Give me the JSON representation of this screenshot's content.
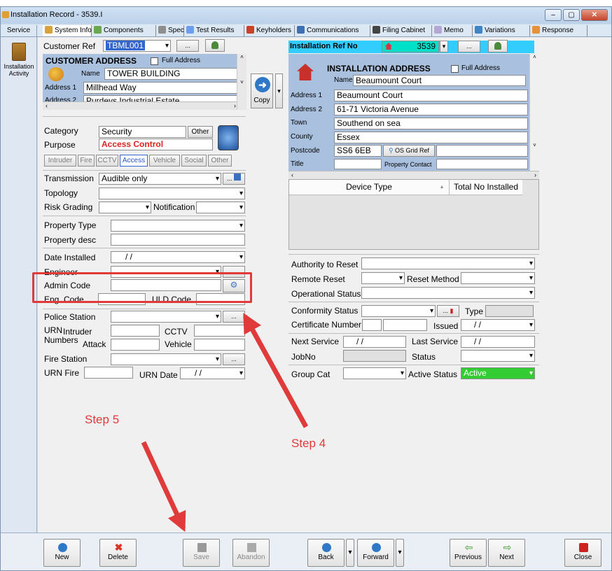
{
  "window": {
    "title": "Installation Record - 3539.I",
    "min": "–",
    "max": "▢",
    "close": "✕"
  },
  "sidebar": {
    "service_tab": "Service",
    "item_label": "Installation Activity"
  },
  "tabs": [
    {
      "label": "System Info",
      "color": "#d9a13a"
    },
    {
      "label": "Components",
      "color": "#6aa84f"
    },
    {
      "label": "Spec",
      "color": "#8e8e8e"
    },
    {
      "label": "Test Results",
      "color": "#6d9eeb"
    },
    {
      "label": "Keyholders",
      "color": "#cc4125"
    },
    {
      "label": "Communications",
      "color": "#3d6fb5"
    },
    {
      "label": "Filing Cabinet",
      "color": "#444444"
    },
    {
      "label": "Memo",
      "color": "#b4a7d6"
    },
    {
      "label": "Variations",
      "color": "#3d85c6"
    },
    {
      "label": "Response",
      "color": "#e69138"
    }
  ],
  "customer": {
    "ref_label": "Customer Ref",
    "ref_value": "TBML001",
    "header": "CUSTOMER  ADDRESS",
    "full_address": "Full Address",
    "name_label": "Name",
    "name_value": "TOWER BUILDING",
    "address1_label": "Address 1",
    "address1_value": "Millhead Way",
    "address2_label": "Address 2",
    "address2_value": "Purdeys Industrial Estate"
  },
  "copy_label": "Copy",
  "category": {
    "category_label": "Category",
    "category_value": "Security",
    "other_btn": "Other",
    "purpose_label": "Purpose",
    "purpose_value": "Access Control",
    "types": [
      "Intruder",
      "Fire",
      "CCTV",
      "Access",
      "Vehicle",
      "Social",
      "Other"
    ]
  },
  "transmission": {
    "label": "Transmission",
    "value": "Audible only",
    "topology": "Topology",
    "risk": "Risk Grading",
    "notification": "Notification"
  },
  "property": {
    "type": "Property Type",
    "desc": "Property desc"
  },
  "install": {
    "date_label": "Date Installed",
    "date_value": "/      /",
    "engineer": "Engineer",
    "admin_code": "Admin Code",
    "eng_code": "Eng. Code",
    "uld_code": "ULD Code"
  },
  "police": {
    "label": "Police Station",
    "urn": "URN",
    "numbers": "Numbers",
    "intruder": "Intruder",
    "cctv": "CCTV",
    "attack": "Attack",
    "vehicle": "Vehicle",
    "fire_station": "Fire  Station",
    "urn_fire": "URN Fire",
    "urn_date": "URN Date",
    "urn_date_value": "/      /"
  },
  "installation": {
    "ref_label": "Installation Ref No",
    "ref_value": "3539",
    "header": "INSTALLATION  ADDRESS",
    "full_address": "Full Address",
    "name_label": "Name",
    "name_value": "Beaumount Court",
    "address1_label": "Address 1",
    "address1_value": "Beaumount Court",
    "address2_label": "Address 2",
    "address2_value": "61-71 Victoria Avenue",
    "town_label": "Town",
    "town_value": "Southend on sea",
    "county_label": "County",
    "county_value": "Essex",
    "postcode_label": "Postcode",
    "postcode_value": "SS6 6EB",
    "grid_ref": "OS Grid Ref",
    "title_label": "Title",
    "contact_label": "Property Contact"
  },
  "devices": {
    "col1": "Device Type",
    "col2": "Total No Installed"
  },
  "status": {
    "authority": "Authority to Reset",
    "remote": "Remote Reset",
    "reset_method": "Reset Method",
    "operational": "Operational Status",
    "conformity": "Conformity Status",
    "type": "Type",
    "cert": "Certificate Number",
    "issued": "Issued",
    "issued_value": "/      /",
    "next_service": "Next Service",
    "next_value": "/      /",
    "last_service": "Last Service",
    "last_value": "/      /",
    "jobno": "JobNo",
    "status": "Status",
    "group_cat": "Group Cat",
    "active_status": "Active Status",
    "active_value": "Active",
    "active_color": "#33cc33"
  },
  "toolbar": {
    "new": "New",
    "delete": "Delete",
    "save": "Save",
    "abandon": "Abandon",
    "back": "Back",
    "forward": "Forward",
    "previous": "Previous",
    "next": "Next",
    "close": "Close"
  },
  "annotations": {
    "step4": "Step 4",
    "step5": "Step 5",
    "color": "#e03a3a"
  }
}
